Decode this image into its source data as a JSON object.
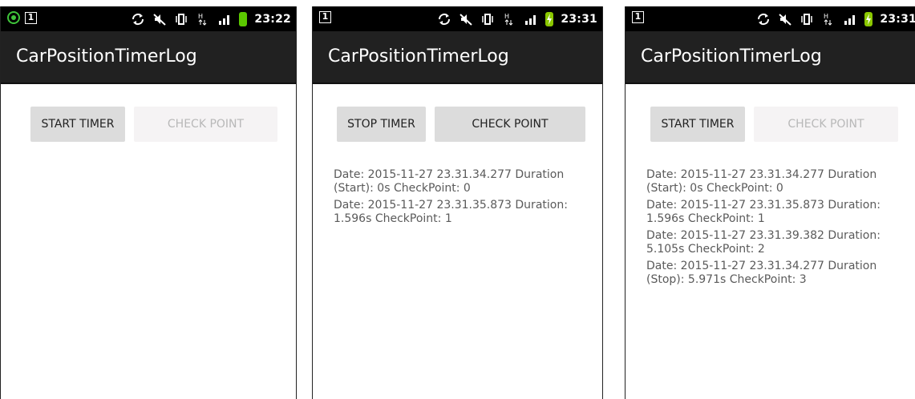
{
  "screens": [
    {
      "status": {
        "time": "23:22",
        "notification_num": "1",
        "battery": "green",
        "left_icons": [
          "whatsapp-icon",
          "notification-icon"
        ]
      },
      "title": "CarPositionTimerLog",
      "buttons": {
        "timer": "START TIMER",
        "checkpoint": "CHECK POINT",
        "checkpoint_enabled": false
      },
      "log": []
    },
    {
      "status": {
        "time": "23:31",
        "notification_num": "1",
        "battery": "charging"
      },
      "title": "CarPositionTimerLog",
      "buttons": {
        "timer": "STOP TIMER",
        "checkpoint": "CHECK POINT",
        "checkpoint_enabled": true
      },
      "log": [
        "Date: 2015-11-27 23.31.34.277 Duration (Start): 0s CheckPoint: 0",
        "Date: 2015-11-27 23.31.35.873 Duration: 1.596s CheckPoint: 1"
      ]
    },
    {
      "status": {
        "time": "23:31",
        "notification_num": "1",
        "battery": "charging"
      },
      "title": "CarPositionTimerLog",
      "buttons": {
        "timer": "START TIMER",
        "checkpoint": "CHECK POINT",
        "checkpoint_enabled": false
      },
      "log": [
        "Date: 2015-11-27 23.31.34.277 Duration (Start): 0s CheckPoint: 0",
        "Date: 2015-11-27 23.31.35.873 Duration: 1.596s CheckPoint: 1",
        "Date: 2015-11-27 23.31.39.382 Duration: 5.105s CheckPoint: 2",
        "Date: 2015-11-27 23.31.34.277 Duration (Stop): 5.971s CheckPoint: 3"
      ]
    }
  ],
  "colors": {
    "statusbar": "#000000",
    "titlebar": "#212121",
    "button": "#dcdcdc",
    "button_disabled": "#f5f3f4",
    "log_text": "#5a5a5a"
  }
}
